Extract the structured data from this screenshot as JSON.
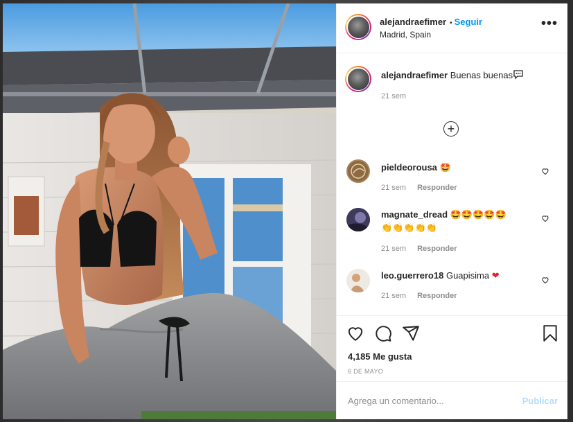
{
  "post": {
    "username": "alejandraefimer",
    "follow_label": "Seguir",
    "separator": "•",
    "location": "Madrid, Spain",
    "more_label": "•••"
  },
  "caption": {
    "username": "alejandraefimer",
    "text": "Buenas buenas",
    "time": "21 sem"
  },
  "load_more": "+",
  "comments": [
    {
      "username": "pieldeorousa",
      "text": "",
      "emoji": [
        "star-struck-emoji"
      ],
      "time": "21 sem",
      "reply_label": "Responder"
    },
    {
      "username": "magnate_dread",
      "text": "",
      "emoji": [
        "star-struck-emoji",
        "star-struck-emoji",
        "star-struck-emoji",
        "star-struck-emoji",
        "star-struck-emoji",
        "clapping-hands-emoji",
        "clapping-hands-emoji",
        "clapping-hands-emoji",
        "clapping-hands-emoji",
        "clapping-hands-emoji"
      ],
      "time": "21 sem",
      "reply_label": "Responder"
    },
    {
      "username": "leo.guerrero18",
      "text": "Guapisima",
      "emoji": [
        "red-heart-emoji"
      ],
      "time": "21 sem",
      "reply_label": "Responder"
    }
  ],
  "actions": {
    "likes": "4,185 Me gusta",
    "date": "6 DE MAYO",
    "icons": [
      "heart-icon",
      "comment-icon",
      "share-icon",
      "bookmark-icon"
    ]
  },
  "add_comment": {
    "placeholder": "Agrega un comentario...",
    "publish_label": "Publicar"
  },
  "colors": {
    "follow": "#0095f6",
    "publish_disabled": "#b2dffc",
    "muted": "#8e8e8e",
    "heart": "#ed4956"
  }
}
